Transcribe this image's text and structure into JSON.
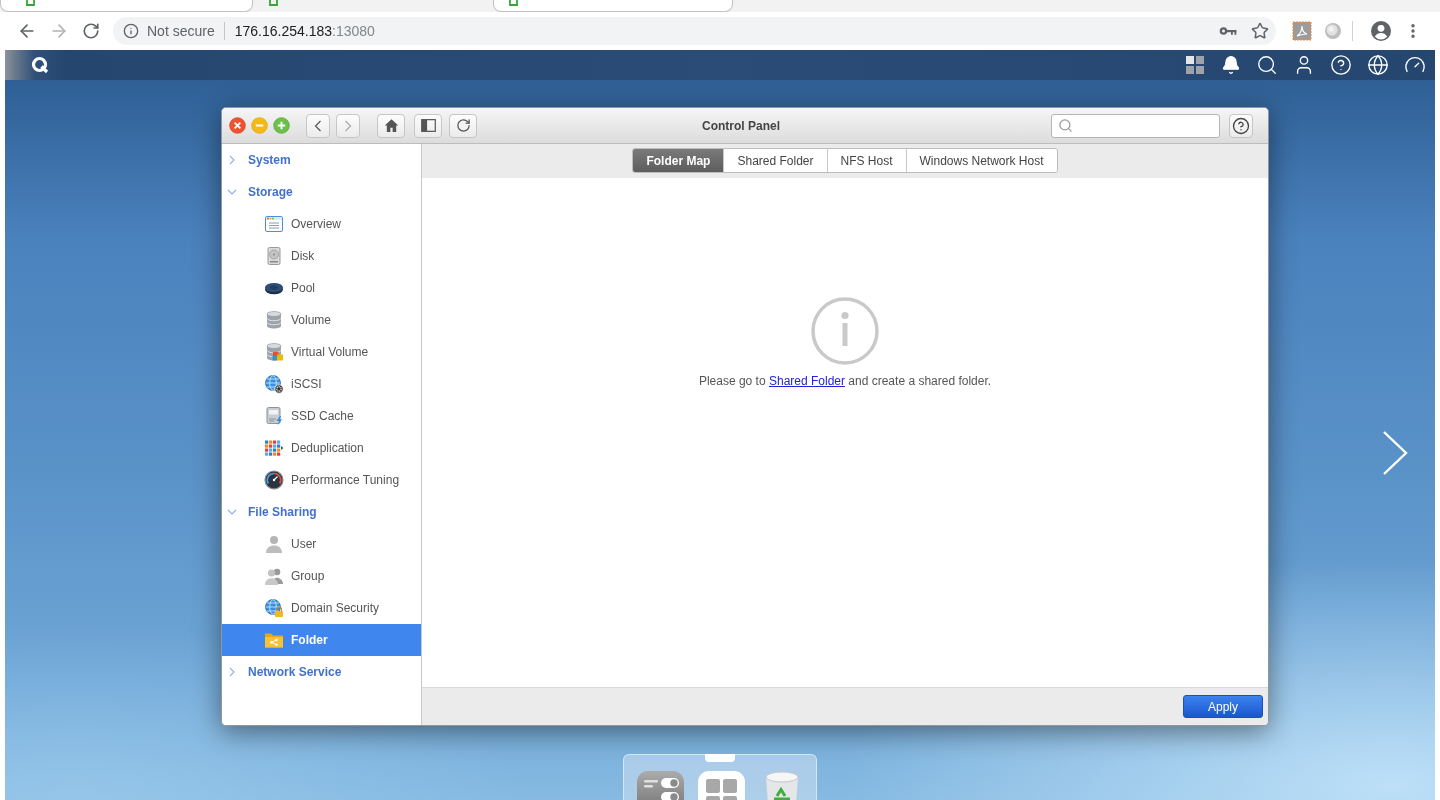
{
  "browser": {
    "tabs": [
      {
        "selected": false
      },
      {
        "selected": true
      },
      {
        "selected": false
      }
    ],
    "address_bar": {
      "security_label": "Not secure",
      "host": "176.16.254.183",
      "port": ":13080"
    }
  },
  "control_panel": {
    "title": "Control Panel",
    "sidebar": [
      {
        "label": "System",
        "expanded": false
      },
      {
        "label": "Storage",
        "expanded": true,
        "children": [
          {
            "label": "Overview",
            "selected": false
          },
          {
            "label": "Disk",
            "selected": false
          },
          {
            "label": "Pool",
            "selected": false
          },
          {
            "label": "Volume",
            "selected": false
          },
          {
            "label": "Virtual Volume",
            "selected": false
          },
          {
            "label": "iSCSI",
            "selected": false
          },
          {
            "label": "SSD Cache",
            "selected": false
          },
          {
            "label": "Deduplication",
            "selected": false
          },
          {
            "label": "Performance Tuning",
            "selected": false
          }
        ]
      },
      {
        "label": "File Sharing",
        "expanded": true,
        "children": [
          {
            "label": "User",
            "selected": false
          },
          {
            "label": "Group",
            "selected": false
          },
          {
            "label": "Domain Security",
            "selected": false
          },
          {
            "label": "Folder",
            "selected": true
          }
        ]
      },
      {
        "label": "Network Service",
        "expanded": false
      }
    ],
    "tabs": [
      {
        "label": "Folder Map",
        "selected": true
      },
      {
        "label": "Shared Folder",
        "selected": false
      },
      {
        "label": "NFS Host",
        "selected": false
      },
      {
        "label": "Windows Network Host",
        "selected": false
      }
    ],
    "message": {
      "before": "Please go to",
      "link": "Shared Folder",
      "after": "and create a shared folder."
    },
    "footer": {
      "buttons": [
        "Apply"
      ]
    }
  }
}
